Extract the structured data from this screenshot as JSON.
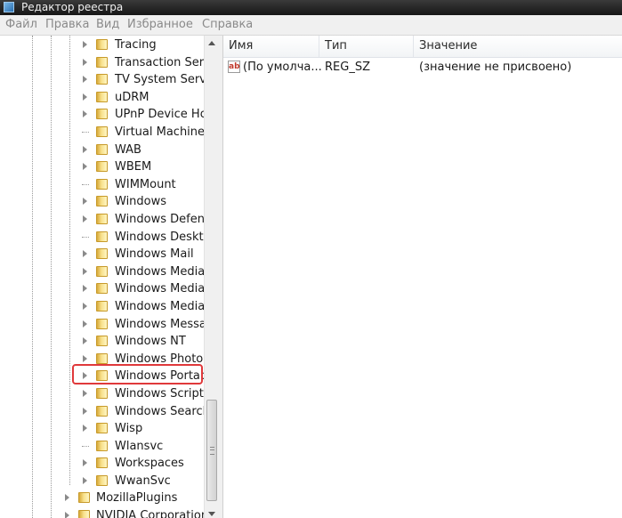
{
  "window": {
    "title": "Редактор реестра"
  },
  "menu": [
    "Файл",
    "Правка",
    "Вид",
    "Избранное",
    "Справка"
  ],
  "tree": {
    "items": [
      {
        "label": "Tracing",
        "expandable": true
      },
      {
        "label": "Transaction Serve",
        "expandable": true
      },
      {
        "label": "TV System Servic",
        "expandable": true
      },
      {
        "label": "uDRM",
        "expandable": true
      },
      {
        "label": "UPnP Device Hos",
        "expandable": true
      },
      {
        "label": "Virtual Machine",
        "expandable": false
      },
      {
        "label": "WAB",
        "expandable": true
      },
      {
        "label": "WBEM",
        "expandable": true
      },
      {
        "label": "WIMMount",
        "expandable": false
      },
      {
        "label": "Windows",
        "expandable": true
      },
      {
        "label": "Windows Defend",
        "expandable": true
      },
      {
        "label": "Windows Deskto",
        "expandable": false
      },
      {
        "label": "Windows Mail",
        "expandable": true
      },
      {
        "label": "Windows Media",
        "expandable": true
      },
      {
        "label": "Windows Media",
        "expandable": true
      },
      {
        "label": "Windows Media",
        "expandable": true
      },
      {
        "label": "Windows Messag",
        "expandable": true
      },
      {
        "label": "Windows NT",
        "expandable": true,
        "highlighted": true
      },
      {
        "label": "Windows Photo V",
        "expandable": true
      },
      {
        "label": "Windows Portab",
        "expandable": true
      },
      {
        "label": "Windows Script H",
        "expandable": true
      },
      {
        "label": "Windows Search",
        "expandable": true
      },
      {
        "label": "Wisp",
        "expandable": true
      },
      {
        "label": "Wlansvc",
        "expandable": false
      },
      {
        "label": "Workspaces",
        "expandable": true
      },
      {
        "label": "WwanSvc",
        "expandable": true
      }
    ],
    "parent_items": [
      {
        "label": "MozillaPlugins",
        "expandable": true
      },
      {
        "label": "NVIDIA Corporation",
        "expandable": true
      }
    ]
  },
  "list": {
    "columns": [
      "Имя",
      "Тип",
      "Значение"
    ],
    "rows": [
      {
        "icon": "string-value-icon",
        "icon_text": "ab",
        "name": "(По умолча...",
        "type": "REG_SZ",
        "value": "(значение не присвоено)"
      }
    ]
  },
  "colors": {
    "highlight_box": "#e0393b",
    "titlebar": "#1e1e1e"
  }
}
